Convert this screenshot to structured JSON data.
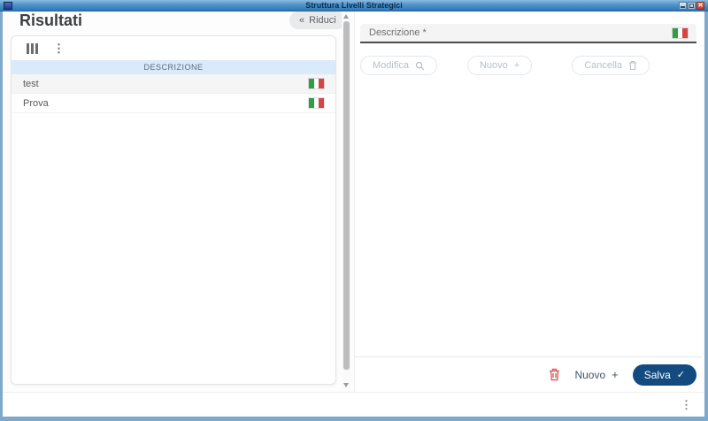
{
  "window": {
    "title": "Struttura Livelli Strategici",
    "controls": {
      "close_glyph": "✕"
    }
  },
  "left_panel": {
    "title": "Risultati",
    "collapse_button": {
      "icon": "«",
      "label": "Riduci"
    },
    "table": {
      "header": "DESCRIZIONE",
      "rows": [
        {
          "label": "test"
        },
        {
          "label": "Prova"
        }
      ]
    }
  },
  "right_panel": {
    "description_field": {
      "label": "Descrizione *",
      "value": ""
    },
    "action_buttons": {
      "modify_label": "Modifica",
      "new_label": "Nuovo",
      "new_icon": "+",
      "delete_label": "Cancella"
    },
    "footer": {
      "new_label": "Nuovo",
      "new_icon": "+",
      "save_label": "Salva",
      "save_icon": "✓"
    }
  },
  "colors": {
    "titlebar_top": "#8cbade",
    "titlebar_bottom": "#2f78b4",
    "window_border": "#7da9cc",
    "table_header_bg": "#d9eafb",
    "accent_blue": "#134b80",
    "danger_red": "#e05c5c",
    "flag_green": "#2f9e44",
    "flag_red": "#d64545"
  }
}
